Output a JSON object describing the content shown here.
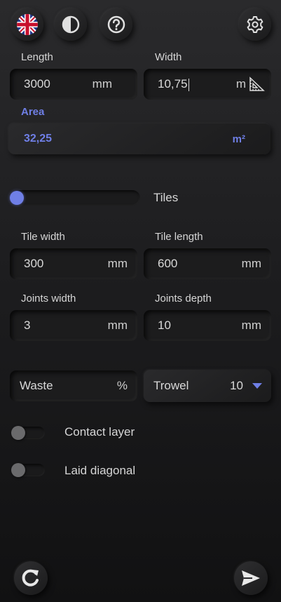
{
  "toolbar": {
    "language_icon": "uk-flag-icon",
    "theme_icon": "contrast-icon",
    "help_icon": "help-icon",
    "settings_icon": "gear-icon"
  },
  "area_section": {
    "length_label": "Length",
    "length_value": "3000",
    "length_unit": "mm",
    "width_label": "Width",
    "width_value": "10,75",
    "width_unit": "m",
    "area_label": "Area",
    "area_value": "32,25",
    "area_unit": "m²"
  },
  "mode_toggle": {
    "label": "Tiles",
    "position": 0
  },
  "tiles": {
    "tile_width_label": "Tile width",
    "tile_width_value": "300",
    "tile_width_unit": "mm",
    "tile_length_label": "Tile length",
    "tile_length_value": "600",
    "tile_length_unit": "mm",
    "joints_width_label": "Joints width",
    "joints_width_value": "3",
    "joints_width_unit": "mm",
    "joints_depth_label": "Joints depth",
    "joints_depth_value": "10",
    "joints_depth_unit": "mm"
  },
  "waste": {
    "placeholder": "Waste",
    "unit": "%"
  },
  "trowel": {
    "label": "Trowel",
    "value": "10"
  },
  "switches": {
    "contact_layer_label": "Contact layer",
    "laid_diagonal_label": "Laid diagonal"
  },
  "footer": {
    "reset_icon": "refresh-icon",
    "send_icon": "send-icon"
  },
  "colors": {
    "accent": "#6f7fe6",
    "background": "#1f1f21"
  }
}
